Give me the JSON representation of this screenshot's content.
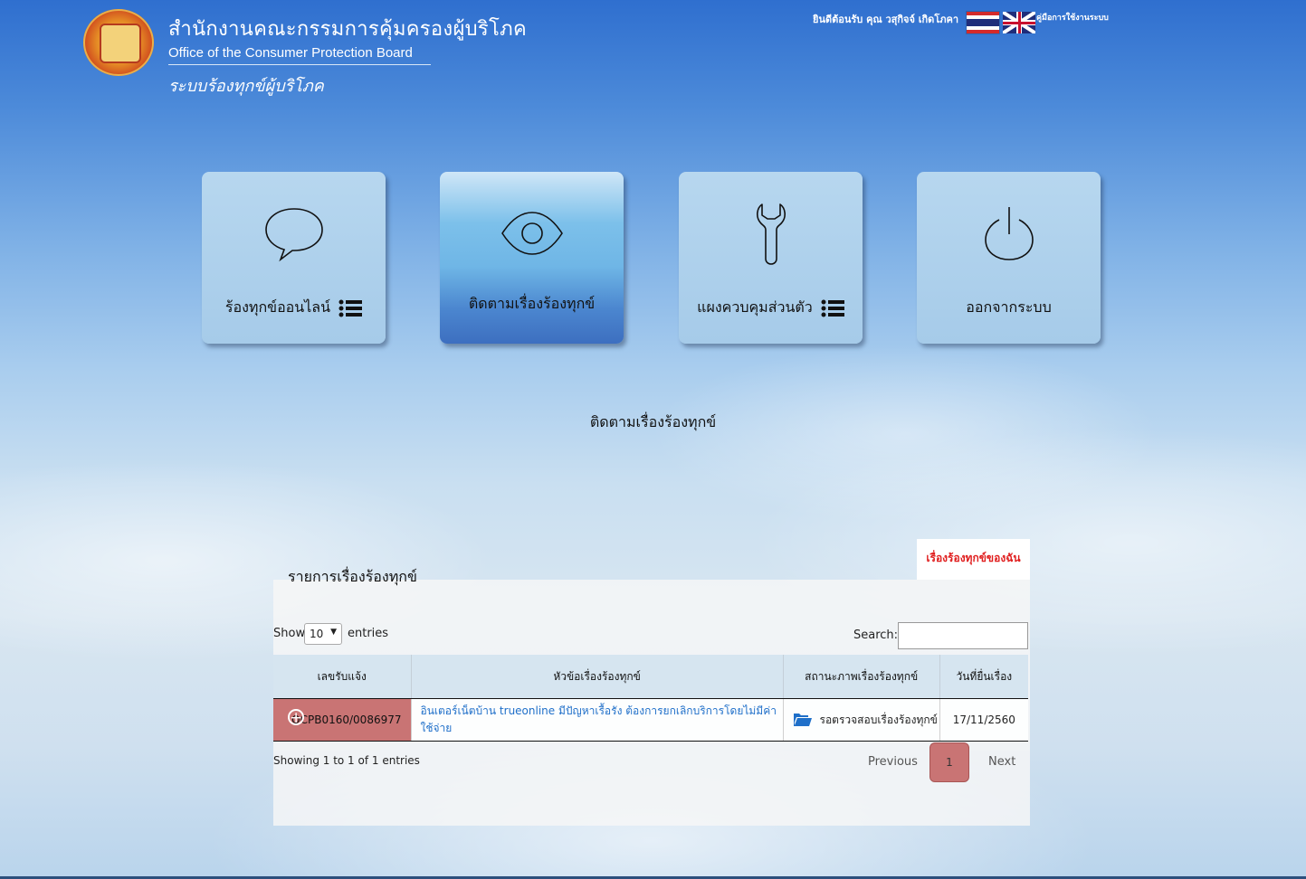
{
  "header": {
    "org_thai": "สำนักงานคณะกรรมการคุ้มครองผู้บริโภค",
    "org_eng": "Office of the Consumer Protection Board",
    "system_thai": "ระบบร้องทุกข์ผู้บริโภค",
    "welcome": "ยินดีต้อนรับ คุณ วสุกิจจ์ เกิดโภคา",
    "manual_link": "คู่มือการใช้งานระบบ"
  },
  "tiles": [
    {
      "label": "ร้องทุกข์ออนไลน์",
      "icon": "speech-bubble-icon",
      "has_list_icon": true
    },
    {
      "label": "ติดตามเรื่องร้องทุกข์",
      "icon": "eye-icon",
      "active": true
    },
    {
      "label": "แผงควบคุมส่วนตัว",
      "icon": "wrench-icon",
      "has_list_icon": true
    },
    {
      "label": "ออกจากระบบ",
      "icon": "power-icon"
    }
  ],
  "section_title": "ติดตามเรื่องร้องทุกข์",
  "panel": {
    "heading": "รายการเรื่องร้องทุกข์",
    "tab_label": "เรื่องร้องทุกข์ของฉัน",
    "show_label": "Show",
    "page_size": "10",
    "entries_label": "entries",
    "search_label": "Search:",
    "search_value": "",
    "columns": [
      "เลขรับแจ้ง",
      "หัวข้อเรื่องร้องทุกข์",
      "สถานะภาพเรื่องร้องทุกข์",
      "วันที่ยื่นเรื่อง"
    ],
    "rows": [
      {
        "id": "OCPB0160/0086977",
        "topic": "อินเตอร์เน็ตบ้าน trueonline มีปัญหาเรื้อรัง ต้องการยกเลิกบริการโดยไม่มีค่าใช้จ่าย",
        "status": "รอตรวจสอบเรื่องร้องทุกข์",
        "date": "17/11/2560"
      }
    ],
    "info": "Showing 1 to 1 of 1 entries",
    "prev": "Previous",
    "current_page": "1",
    "next": "Next"
  },
  "colors": {
    "accent_row": "#c97474",
    "link": "#1f6fc9",
    "tab_text": "#e01e1e",
    "active_tile": "#4b86cf"
  }
}
